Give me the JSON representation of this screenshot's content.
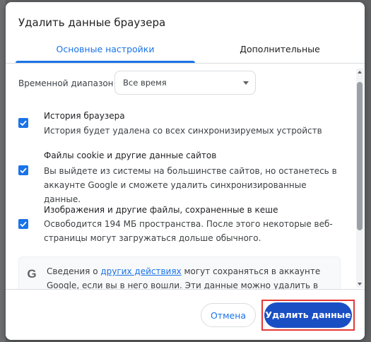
{
  "dialog": {
    "title": "Удалить данные браузера",
    "tabs": [
      {
        "label": "Основные настройки",
        "active": true
      },
      {
        "label": "Дополнительные",
        "active": false
      }
    ],
    "time_range": {
      "label": "Временной диапазон",
      "selected": "Все время"
    },
    "items": [
      {
        "title": "История браузера",
        "description": "История будет удалена со всех синхронизируемых устройств",
        "checked": true
      },
      {
        "title": "Файлы cookie и другие данные сайтов",
        "description": "Вы выйдете из системы на большинстве сайтов, но останетесь в аккаунте Google и сможете удалить синхронизированные данные.",
        "checked": true
      },
      {
        "title": "Изображения и другие файлы, сохраненные в кеше",
        "description": "Освободится 194 МБ пространства. После этого некоторые веб-страницы могут загружаться дольше обычного.",
        "checked": true
      }
    ],
    "google_notice": {
      "icon": "google-g-icon",
      "text_before": "Сведения о ",
      "link_text": "других действиях",
      "text_after": " могут сохраняться в аккаунте Google, если вы в него вошли. Эти данные можно удалить в любое время."
    },
    "buttons": {
      "cancel": "Отмена",
      "delete": "Удалить данные"
    }
  },
  "colors": {
    "accent": "#1a73e8",
    "primary_button": "#1a4fc4",
    "highlight": "#e53935"
  }
}
